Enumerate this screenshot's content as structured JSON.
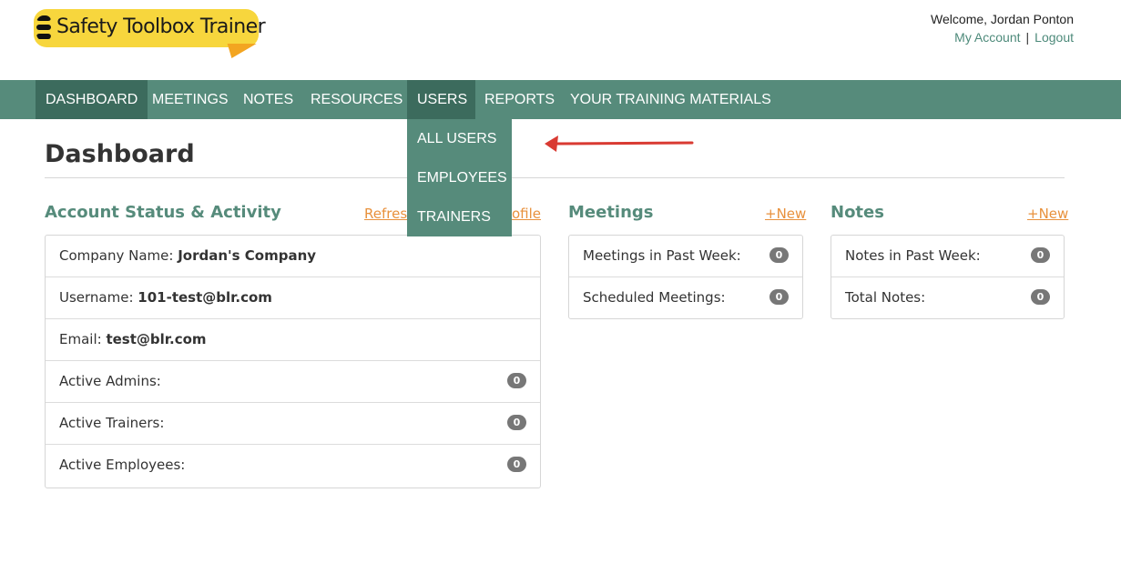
{
  "header": {
    "logo_text": "Safety Toolbox Trainer",
    "welcome": "Welcome, Jordan Ponton",
    "my_account": "My Account",
    "separator": "|",
    "logout": "Logout"
  },
  "nav": {
    "items": [
      {
        "label": "DASHBOARD"
      },
      {
        "label": "MEETINGS"
      },
      {
        "label": "NOTES"
      },
      {
        "label": "RESOURCES"
      },
      {
        "label": "USERS"
      },
      {
        "label": "REPORTS"
      },
      {
        "label": "YOUR TRAINING MATERIALS"
      }
    ],
    "users_dropdown": [
      {
        "label": "ALL USERS"
      },
      {
        "label": "EMPLOYEES"
      },
      {
        "label": "TRAINERS"
      }
    ]
  },
  "page": {
    "title": "Dashboard"
  },
  "account": {
    "heading": "Account Status & Activity",
    "link_left": "Refres",
    "link_right": "ofile",
    "company_label": "Company Name: ",
    "company_value": "Jordan's Company",
    "username_label": "Username: ",
    "username_value": "101-test@blr.com",
    "email_label": "Email: ",
    "email_value": "test@blr.com",
    "active_admins_label": "Active Admins:",
    "active_admins_count": "0",
    "active_trainers_label": "Active Trainers:",
    "active_trainers_count": "0",
    "active_employees_label": "Active Employees:",
    "active_employees_count": "0"
  },
  "meetings": {
    "heading": "Meetings",
    "new_link": "+New",
    "past_week_label": "Meetings in Past Week:",
    "past_week_count": "0",
    "scheduled_label": "Scheduled Meetings:",
    "scheduled_count": "0"
  },
  "notes": {
    "heading": "Notes",
    "new_link": "+New",
    "past_week_label": "Notes in Past Week:",
    "past_week_count": "0",
    "total_label": "Total Notes:",
    "total_count": "0"
  },
  "colors": {
    "nav_bg": "#568b7b",
    "nav_active": "#3c6b5d",
    "accent_link": "#e8913c",
    "arrow": "#d93a32"
  }
}
